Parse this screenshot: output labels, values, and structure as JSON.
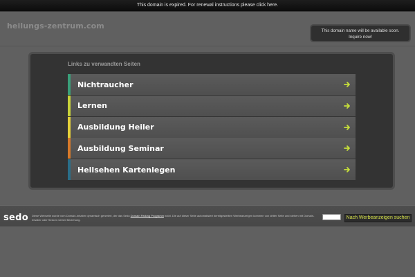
{
  "topbar": {
    "notice": "This domain is expired. For renewal instructions please click here."
  },
  "header": {
    "domain": "heilungs-zentrum.com"
  },
  "availability": {
    "line1": "This domain name will be available soon.",
    "line2": "Inquire now!"
  },
  "links_section": {
    "heading": "Links zu verwandten Seiten",
    "items": [
      {
        "label": "Nichtraucher",
        "accent": "#3aa07a"
      },
      {
        "label": "Lernen",
        "accent": "#c9d43a"
      },
      {
        "label": "Ausbildung Heiler",
        "accent": "#e6d23a"
      },
      {
        "label": "Ausbildung Seminar",
        "accent": "#d87a2a"
      },
      {
        "label": "Hellsehen Kartenlegen",
        "accent": "#2a6f8a"
      }
    ],
    "arrow_color": "#c7e03a"
  },
  "footer": {
    "logo": "sedo",
    "disclaimer_part1": "Diese Webseite wurde vom Domain-Inhaber dynamisch generiert, der das Sedo ",
    "disclaimer_link": "Domain Parking Programm",
    "disclaimer_part2": " nutzt. Die auf dieser Seite automatisiert bereitgestellten Werbeanzeigen kommen von dritter Seite und stehen mit Domain-Inhaber oder Sedo in keiner Beziehung.",
    "search_value": "",
    "search_button": "Nach Werbeanzeigen suchen"
  }
}
